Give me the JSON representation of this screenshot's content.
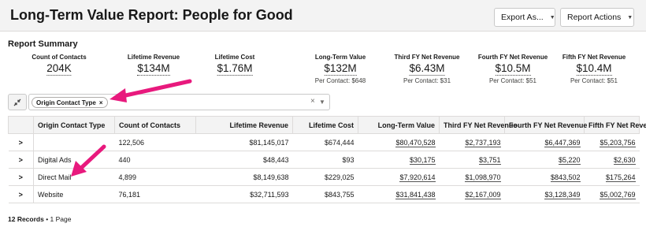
{
  "header": {
    "title": "Long-Term Value Report: People for Good",
    "export_label": "Export As...",
    "actions_label": "Report Actions"
  },
  "summary": {
    "label": "Report Summary",
    "metrics": [
      {
        "label": "Count of Contacts",
        "value": "204K",
        "sub": ""
      },
      {
        "label": "Lifetime Revenue",
        "value": "$134M",
        "sub": ""
      },
      {
        "label": "Lifetime Cost",
        "value": "$1.76M",
        "sub": ""
      },
      {
        "label": "Long-Term Value",
        "value": "$132M",
        "sub": "Per Contact: $648"
      },
      {
        "label": "Third FY Net Revenue",
        "value": "$6.43M",
        "sub": "Per Contact: $31"
      },
      {
        "label": "Fourth FY Net Revenue",
        "value": "$10.5M",
        "sub": "Per Contact: $51"
      },
      {
        "label": "Fifth FY Net Revenue",
        "value": "$10.4M",
        "sub": "Per Contact: $51"
      }
    ]
  },
  "filter": {
    "pill_label": "Origin Contact Type",
    "pill_remove": "×",
    "clear": "×",
    "caret": "▼",
    "toggle_icon": "collapse-arrows-icon"
  },
  "table": {
    "columns": [
      "",
      "Origin Contact Type",
      "Count of Contacts",
      "Lifetime Revenue",
      "Lifetime Cost",
      "Long-Term Value",
      "Third FY Net Revenue",
      "Fourth FY Net Revenue",
      "Fifth FY Net Revenue"
    ],
    "rows": [
      {
        "expander": ">",
        "type": "",
        "count": "122,506",
        "revenue": "$81,145,017",
        "cost": "$674,444",
        "ltv": "$80,470,528",
        "fy3": "$2,737,193",
        "fy4": "$6,447,369",
        "fy5": "$5,203,756"
      },
      {
        "expander": ">",
        "type": "Digital Ads",
        "count": "440",
        "revenue": "$48,443",
        "cost": "$93",
        "ltv": "$30,175",
        "fy3": "$3,751",
        "fy4": "$5,220",
        "fy5": "$2,630"
      },
      {
        "expander": ">",
        "type": "Direct Mail",
        "count": "4,899",
        "revenue": "$8,149,638",
        "cost": "$229,025",
        "ltv": "$7,920,614",
        "fy3": "$1,098,970",
        "fy4": "$843,502",
        "fy5": "$175,264"
      },
      {
        "expander": ">",
        "type": "Website",
        "count": "76,181",
        "revenue": "$32,711,593",
        "cost": "$843,755",
        "ltv": "$31,841,438",
        "fy3": "$2,167,009",
        "fy4": "$3,128,349",
        "fy5": "$5,002,769"
      }
    ]
  },
  "footer": {
    "records": "12 Records",
    "pages": " • 1 Page"
  },
  "colors": {
    "annotation_arrow": "#e8197d",
    "header_bg": "#f3f3f3"
  }
}
